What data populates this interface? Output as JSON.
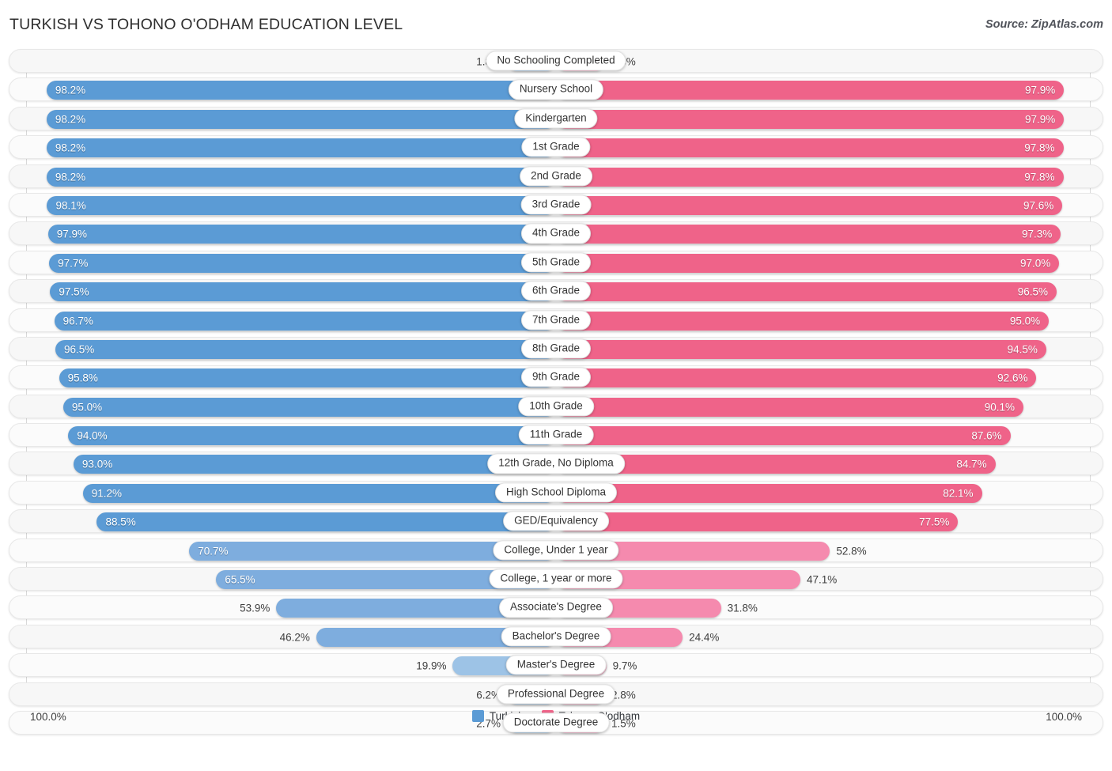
{
  "header": {
    "title": "TURKISH VS TOHONO O'ODHAM EDUCATION LEVEL",
    "source": "Source: ZipAtlas.com"
  },
  "legend": {
    "items": [
      {
        "label": "Turkish",
        "color": "#5b9bd5"
      },
      {
        "label": "Tohono O'odham",
        "color": "#ef6389"
      }
    ]
  },
  "axis": {
    "left_label": "100.0%",
    "right_label": "100.0%"
  },
  "colors": {
    "blue_strong": "#5b9bd5",
    "blue_mid": "#7eadde",
    "blue_light": "#9dc3e6",
    "pink_strong": "#ef6389",
    "pink_mid": "#f58aae",
    "pink_light": "#f7a8c4",
    "row_bg": "#f7f7f7",
    "gridline": "#d9d9d9"
  },
  "chart_data": {
    "type": "bar",
    "title": "TURKISH VS TOHONO O'ODHAM EDUCATION LEVEL",
    "subtitle": "Source: ZipAtlas.com",
    "orientation": "horizontal-diverging",
    "xlabel": "",
    "ylabel": "",
    "xlim": [
      0,
      100
    ],
    "grid": false,
    "legend_position": "bottom-center",
    "categories": [
      "No Schooling Completed",
      "Nursery School",
      "Kindergarten",
      "1st Grade",
      "2nd Grade",
      "3rd Grade",
      "4th Grade",
      "5th Grade",
      "6th Grade",
      "7th Grade",
      "8th Grade",
      "9th Grade",
      "10th Grade",
      "11th Grade",
      "12th Grade, No Diploma",
      "High School Diploma",
      "GED/Equivalency",
      "College, Under 1 year",
      "College, 1 year or more",
      "Associate's Degree",
      "Bachelor's Degree",
      "Master's Degree",
      "Professional Degree",
      "Doctorate Degree"
    ],
    "series": [
      {
        "name": "Turkish",
        "color": "#5b9bd5",
        "values": [
          1.8,
          98.2,
          98.2,
          98.2,
          98.2,
          98.1,
          97.9,
          97.7,
          97.5,
          96.7,
          96.5,
          95.8,
          95.0,
          94.0,
          93.0,
          91.2,
          88.5,
          70.7,
          65.5,
          53.9,
          46.2,
          19.9,
          6.2,
          2.7
        ]
      },
      {
        "name": "Tohono O'odham",
        "color": "#ef6389",
        "values": [
          2.3,
          97.9,
          97.9,
          97.8,
          97.8,
          97.6,
          97.3,
          97.0,
          96.5,
          95.0,
          94.5,
          92.6,
          90.1,
          87.6,
          84.7,
          82.1,
          77.5,
          52.8,
          47.1,
          31.8,
          24.4,
          9.7,
          2.8,
          1.5
        ]
      }
    ]
  },
  "rows": [
    {
      "label": "No Schooling Completed",
      "left": "1.8%",
      "right": "2.3%",
      "left_val": 1.8,
      "right_val": 2.3
    },
    {
      "label": "Nursery School",
      "left": "98.2%",
      "right": "97.9%",
      "left_val": 98.2,
      "right_val": 97.9
    },
    {
      "label": "Kindergarten",
      "left": "98.2%",
      "right": "97.9%",
      "left_val": 98.2,
      "right_val": 97.9
    },
    {
      "label": "1st Grade",
      "left": "98.2%",
      "right": "97.8%",
      "left_val": 98.2,
      "right_val": 97.8
    },
    {
      "label": "2nd Grade",
      "left": "98.2%",
      "right": "97.8%",
      "left_val": 98.2,
      "right_val": 97.8
    },
    {
      "label": "3rd Grade",
      "left": "98.1%",
      "right": "97.6%",
      "left_val": 98.1,
      "right_val": 97.6
    },
    {
      "label": "4th Grade",
      "left": "97.9%",
      "right": "97.3%",
      "left_val": 97.9,
      "right_val": 97.3
    },
    {
      "label": "5th Grade",
      "left": "97.7%",
      "right": "97.0%",
      "left_val": 97.7,
      "right_val": 97.0
    },
    {
      "label": "6th Grade",
      "left": "97.5%",
      "right": "96.5%",
      "left_val": 97.5,
      "right_val": 96.5
    },
    {
      "label": "7th Grade",
      "left": "96.7%",
      "right": "95.0%",
      "left_val": 96.7,
      "right_val": 95.0
    },
    {
      "label": "8th Grade",
      "left": "96.5%",
      "right": "94.5%",
      "left_val": 96.5,
      "right_val": 94.5
    },
    {
      "label": "9th Grade",
      "left": "95.8%",
      "right": "92.6%",
      "left_val": 95.8,
      "right_val": 92.6
    },
    {
      "label": "10th Grade",
      "left": "95.0%",
      "right": "90.1%",
      "left_val": 95.0,
      "right_val": 90.1
    },
    {
      "label": "11th Grade",
      "left": "94.0%",
      "right": "87.6%",
      "left_val": 94.0,
      "right_val": 87.6
    },
    {
      "label": "12th Grade, No Diploma",
      "left": "93.0%",
      "right": "84.7%",
      "left_val": 93.0,
      "right_val": 84.7
    },
    {
      "label": "High School Diploma",
      "left": "91.2%",
      "right": "82.1%",
      "left_val": 91.2,
      "right_val": 82.1
    },
    {
      "label": "GED/Equivalency",
      "left": "88.5%",
      "right": "77.5%",
      "left_val": 88.5,
      "right_val": 77.5
    },
    {
      "label": "College, Under 1 year",
      "left": "70.7%",
      "right": "52.8%",
      "left_val": 70.7,
      "right_val": 52.8
    },
    {
      "label": "College, 1 year or more",
      "left": "65.5%",
      "right": "47.1%",
      "left_val": 65.5,
      "right_val": 47.1
    },
    {
      "label": "Associate's Degree",
      "left": "53.9%",
      "right": "31.8%",
      "left_val": 53.9,
      "right_val": 31.8
    },
    {
      "label": "Bachelor's Degree",
      "left": "46.2%",
      "right": "24.4%",
      "left_val": 46.2,
      "right_val": 24.4
    },
    {
      "label": "Master's Degree",
      "left": "19.9%",
      "right": "9.7%",
      "left_val": 19.9,
      "right_val": 9.7
    },
    {
      "label": "Professional Degree",
      "left": "6.2%",
      "right": "2.8%",
      "left_val": 6.2,
      "right_val": 2.8
    },
    {
      "label": "Doctorate Degree",
      "left": "2.7%",
      "right": "1.5%",
      "left_val": 2.7,
      "right_val": 1.5
    }
  ]
}
